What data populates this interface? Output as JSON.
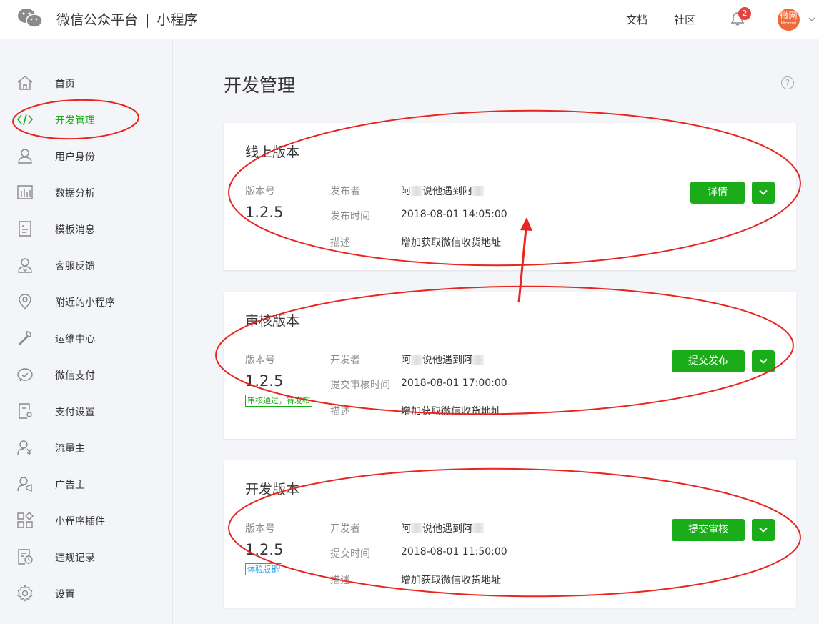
{
  "header": {
    "brand": "微信公众平台",
    "separator": "|",
    "product": "小程序",
    "links": [
      "文档",
      "社区"
    ],
    "notification_count": "2",
    "avatar_text": "微网",
    "avatar_subtext": "Micronet"
  },
  "sidebar": {
    "active": "开发管理",
    "items": [
      {
        "label": "首页",
        "icon": "home-icon"
      },
      {
        "label": "开发管理",
        "icon": "code-icon"
      },
      {
        "label": "用户身份",
        "icon": "user-icon"
      },
      {
        "label": "数据分析",
        "icon": "chart-icon"
      },
      {
        "label": "模板消息",
        "icon": "document-icon"
      },
      {
        "label": "客服反馈",
        "icon": "service-icon"
      },
      {
        "label": "附近的小程序",
        "icon": "location-icon"
      },
      {
        "label": "运维中心",
        "icon": "wrench-icon"
      },
      {
        "label": "微信支付",
        "icon": "payment-icon"
      },
      {
        "label": "支付设置",
        "icon": "payment-settings-icon"
      },
      {
        "label": "流量主",
        "icon": "traffic-owner-icon"
      },
      {
        "label": "广告主",
        "icon": "advertiser-icon"
      },
      {
        "label": "小程序插件",
        "icon": "plugin-icon"
      },
      {
        "label": "违规记录",
        "icon": "violation-record-icon"
      },
      {
        "label": "设置",
        "icon": "gear-icon"
      }
    ]
  },
  "main": {
    "title": "开发管理",
    "help_glyph": "?",
    "online": {
      "title": "线上版本",
      "version_label": "版本号",
      "version": "1.2.5",
      "rows": [
        {
          "label": "发布者",
          "value_prefix": "阿",
          "value_mid": "说他遇到阿"
        },
        {
          "label": "发布时间",
          "value": "2018-08-01 14:05:00"
        },
        {
          "label": "描述",
          "value": "增加获取微信收货地址"
        }
      ],
      "button": "详情"
    },
    "review": {
      "title": "审核版本",
      "version_label": "版本号",
      "version": "1.2.5",
      "status_tag": "审核通过，待发布",
      "rows": [
        {
          "label": "开发者",
          "value_prefix": "阿",
          "value_mid": "说他遇到阿"
        },
        {
          "label": "提交审核时间",
          "value": "2018-08-01 17:00:00"
        },
        {
          "label": "描述",
          "value": "增加获取微信收货地址"
        }
      ],
      "button": "提交发布"
    },
    "dev": {
      "title": "开发版本",
      "version_label": "版本号",
      "version": "1.2.5",
      "status_tag": "体验版",
      "rows": [
        {
          "label": "开发者",
          "value_prefix": "阿",
          "value_mid": "说他遇到阿"
        },
        {
          "label": "提交时间",
          "value": "2018-08-01 11:50:00"
        },
        {
          "label": "描述",
          "value": "增加获取微信收货地址"
        }
      ],
      "button": "提交审核"
    }
  },
  "colors": {
    "accent": "#1aad19",
    "annotation": "#e8251f",
    "badge": "#e64340",
    "avatar": "#ef6a3a",
    "experience_tag": "#1aa0e6"
  }
}
